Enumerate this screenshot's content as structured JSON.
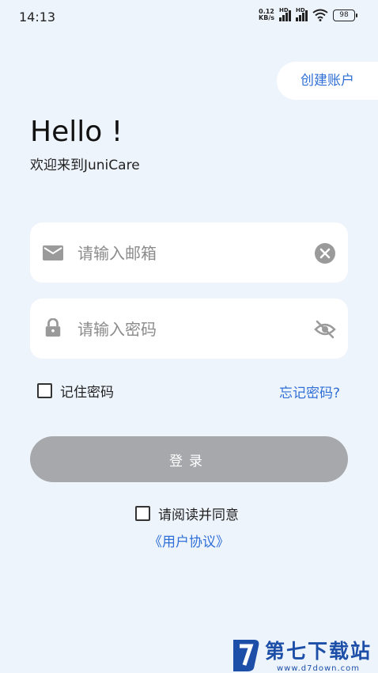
{
  "status_bar": {
    "time": "14:13",
    "net_speed_value": "0.12",
    "net_speed_unit": "KB/s",
    "signal_label": "HD",
    "battery": "98"
  },
  "header": {
    "create_account": "创建账户",
    "greeting": "Hello !",
    "welcome": "欢迎来到JuniCare"
  },
  "form": {
    "email_placeholder": "请输入邮箱",
    "password_placeholder": "请输入密码",
    "remember_label": "记住密码",
    "forgot_label": "忘记密码?",
    "login_label": "登录",
    "agree_label": "请阅读并同意",
    "agreement_link": "《用户协议》"
  },
  "watermark": {
    "title": "第七下载站",
    "url": "www.d7down.com"
  },
  "colors": {
    "background": "#eef4fc",
    "accent": "#2f6fd6",
    "button_disabled": "#a7a8ab"
  },
  "icons": [
    "mail-icon",
    "clear-icon",
    "lock-icon",
    "eye-off-icon",
    "wifi-icon",
    "signal-icon",
    "battery-icon"
  ]
}
